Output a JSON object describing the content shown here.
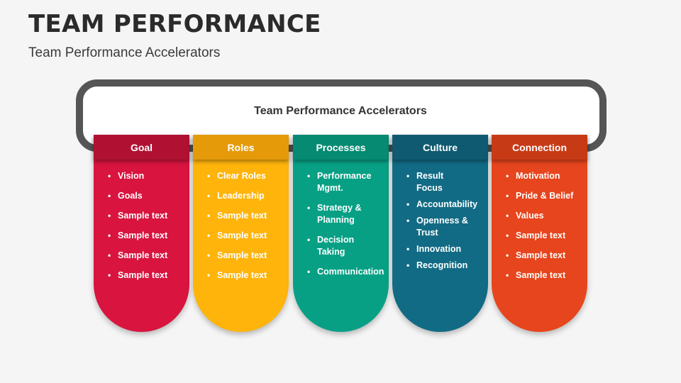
{
  "title": "TEAM PERFORMANCE",
  "subtitle": "Team Performance Accelerators",
  "frame_title": "Team Performance Accelerators",
  "columns": [
    {
      "name": "Goal",
      "color": "#d8143f",
      "head_color": "#b01133",
      "items": [
        "Vision",
        "Goals",
        "Sample text",
        "Sample text",
        "Sample text",
        "Sample text"
      ]
    },
    {
      "name": "Roles",
      "color": "#ffb40b",
      "head_color": "#e59a0a",
      "items": [
        "Clear Roles",
        "Leadership",
        "Sample text",
        "Sample text",
        "Sample text",
        "Sample text"
      ]
    },
    {
      "name": "Processes",
      "color": "#07a085",
      "head_color": "#068a72",
      "items": [
        "Performance Mgmt.",
        "Strategy & Planning",
        "Decision Taking",
        "Communication"
      ]
    },
    {
      "name": "Culture",
      "color": "#126b84",
      "head_color": "#0f5a70",
      "items": [
        "Result Focus",
        "Accountability",
        "Openness & Trust",
        "Innovation",
        "Recognition"
      ]
    },
    {
      "name": "Connection",
      "color": "#e7451d",
      "head_color": "#c73a16",
      "items": [
        "Motivation",
        "Pride & Belief",
        "Values",
        "Sample text",
        "Sample text",
        "Sample text"
      ]
    }
  ]
}
